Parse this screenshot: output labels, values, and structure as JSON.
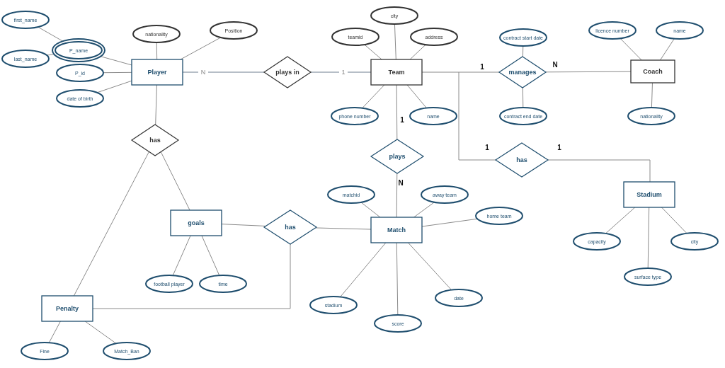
{
  "entities": [
    {
      "name": "Player",
      "color": "#1f4e6e"
    },
    {
      "name": "Team",
      "color": "#333333"
    },
    {
      "name": "Coach",
      "color": "#333333"
    },
    {
      "name": "goals",
      "color": "#1f4e6e"
    },
    {
      "name": "Match",
      "color": "#1f4e6e"
    },
    {
      "name": "Stadium",
      "color": "#1f4e6e"
    },
    {
      "name": "Penalty",
      "color": "#1f4e6e"
    }
  ],
  "relationships": [
    {
      "name": "plays in",
      "color": "#333333"
    },
    {
      "name": "has",
      "color": "#333333"
    },
    {
      "name": "manages",
      "color": "#1f4e6e"
    },
    {
      "name": "plays",
      "color": "#1f4e6e"
    },
    {
      "name": "has",
      "color": "#1f4e6e"
    },
    {
      "name": "has",
      "color": "#1f4e6e"
    }
  ],
  "attributes": [
    {
      "label": "first_name",
      "kind": "simple",
      "color": "#1f4e6e"
    },
    {
      "label": "last_name",
      "kind": "simple",
      "color": "#1f4e6e"
    },
    {
      "label": "P_name",
      "kind": "multivalued",
      "color": "#1f4e6e"
    },
    {
      "label": "P_id",
      "kind": "simple",
      "color": "#1f4e6e"
    },
    {
      "label": "date of birth",
      "kind": "simple",
      "color": "#1f4e6e"
    },
    {
      "label": "nationality",
      "kind": "simple",
      "color": "#333333"
    },
    {
      "label": "Position",
      "kind": "simple",
      "color": "#333333"
    },
    {
      "label": "teamid",
      "kind": "simple",
      "color": "#333333"
    },
    {
      "label": "city",
      "kind": "simple",
      "color": "#333333"
    },
    {
      "label": "address",
      "kind": "simple",
      "color": "#333333"
    },
    {
      "label": "phone number",
      "kind": "simple",
      "color": "#1f4e6e"
    },
    {
      "label": "name",
      "kind": "simple",
      "color": "#1f4e6e"
    },
    {
      "label": "contract start date",
      "kind": "simple",
      "color": "#1f4e6e"
    },
    {
      "label": "contract end date",
      "kind": "simple",
      "color": "#1f4e6e"
    },
    {
      "label": "licence number",
      "kind": "simple",
      "color": "#1f4e6e"
    },
    {
      "label": "name",
      "kind": "simple",
      "color": "#1f4e6e"
    },
    {
      "label": "nationality",
      "kind": "simple",
      "color": "#1f4e6e"
    },
    {
      "label": "matchid",
      "kind": "simple",
      "color": "#1f4e6e"
    },
    {
      "label": "away team",
      "kind": "simple",
      "color": "#1f4e6e"
    },
    {
      "label": "home team",
      "kind": "simple",
      "color": "#1f4e6e"
    },
    {
      "label": "stadium",
      "kind": "simple",
      "color": "#1f4e6e"
    },
    {
      "label": "score",
      "kind": "simple",
      "color": "#1f4e6e"
    },
    {
      "label": "date",
      "kind": "simple",
      "color": "#1f4e6e"
    },
    {
      "label": "capacity",
      "kind": "simple",
      "color": "#1f4e6e"
    },
    {
      "label": "city",
      "kind": "simple",
      "color": "#1f4e6e"
    },
    {
      "label": "surface type",
      "kind": "simple",
      "color": "#1f4e6e"
    },
    {
      "label": "football player",
      "kind": "simple",
      "color": "#1f4e6e"
    },
    {
      "label": "time",
      "kind": "simple",
      "color": "#1f4e6e"
    },
    {
      "label": "Fine",
      "kind": "simple",
      "color": "#1f4e6e"
    },
    {
      "label": "Match_Ban",
      "kind": "simple",
      "color": "#1f4e6e"
    }
  ],
  "cardinalities": [
    {
      "label": "N",
      "kind": "line_label"
    },
    {
      "label": "1",
      "kind": "line_label"
    },
    {
      "label": "1",
      "kind": "bold"
    },
    {
      "label": "N",
      "kind": "bold"
    },
    {
      "label": "1",
      "kind": "bold"
    },
    {
      "label": "N",
      "kind": "bold"
    },
    {
      "label": "1",
      "kind": "bold"
    },
    {
      "label": "1",
      "kind": "bold"
    }
  ]
}
